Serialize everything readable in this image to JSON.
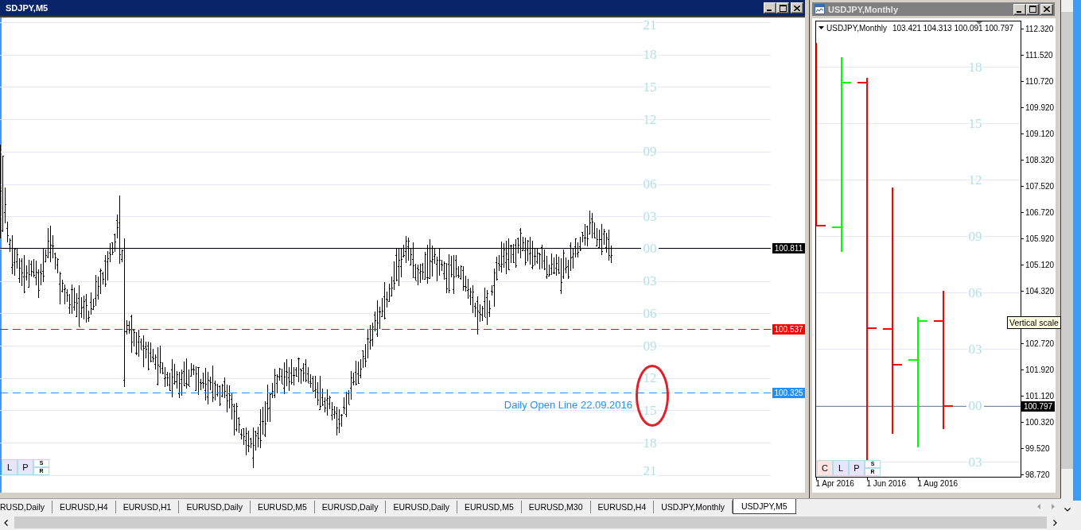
{
  "m5_window": {
    "title": "SDJPY,M5",
    "active": true,
    "hour_labels": [
      "21",
      "18",
      "15",
      "12",
      "09",
      "06",
      "03",
      "00",
      "03",
      "06",
      "09",
      "12",
      "15",
      "18",
      "21"
    ],
    "price_lines": [
      {
        "kind": "solid",
        "color": "#000000",
        "tag": "100.811"
      },
      {
        "kind": "dashed",
        "color": "#ff0000",
        "tag": "100.537"
      },
      {
        "kind": "dashed",
        "color": "#1e90ff",
        "tag": "100.325",
        "label": "Daily Open Line 22.09.2016"
      }
    ],
    "annotations": [
      {
        "kind": "ellipse"
      }
    ],
    "buttons": [
      {
        "label": "L",
        "color": "#e6e6fa"
      },
      {
        "label": "P",
        "color": "#e6e6fa"
      }
    ],
    "stacked_buttons": [
      "S",
      "R"
    ]
  },
  "monthly_window": {
    "title": "USDJPY,Monthly",
    "active": false,
    "legend": {
      "symbol": "USDJPY,Monthly",
      "values": [
        "103.421",
        "104.313",
        "100.091",
        "100.797"
      ]
    },
    "hour_labels": [
      "18",
      "15",
      "12",
      "09",
      "06",
      "03",
      "00",
      "03"
    ],
    "bid_tag": "100.797",
    "price_axis": [
      "112.320",
      "111.520",
      "110.720",
      "109.920",
      "109.120",
      "108.320",
      "107.520",
      "106.720",
      "105.920",
      "105.120",
      "104.320",
      "102.720",
      "101.920",
      "101.120",
      "100.320",
      "99.520",
      "98.720"
    ],
    "date_axis": [
      "1 Apr 2016",
      "1 Jun 2016",
      "1 Aug 2016"
    ],
    "buttons": [
      {
        "label": "C",
        "color": "#ffe4e1"
      },
      {
        "label": "L",
        "color": "#e6e6fa"
      },
      {
        "label": "P",
        "color": "#e6e6fa"
      }
    ],
    "stacked_buttons": [
      "S",
      "R"
    ],
    "tooltip": "Vertical scale"
  },
  "tabs": [
    {
      "label": "RUSD,Daily",
      "selected": false
    },
    {
      "label": "EURUSD,H4",
      "selected": false
    },
    {
      "label": "EURUSD,H1",
      "selected": false
    },
    {
      "label": "EURUSD,Daily",
      "selected": false
    },
    {
      "label": "EURUSD,M5",
      "selected": false
    },
    {
      "label": "EURUSD,Daily",
      "selected": false
    },
    {
      "label": "EURUSD,Daily",
      "selected": false
    },
    {
      "label": "EURUSD,M5",
      "selected": false
    },
    {
      "label": "EURUSD,M30",
      "selected": false
    },
    {
      "label": "EURUSD,H4",
      "selected": false
    },
    {
      "label": "USDJPY,Monthly",
      "selected": false
    },
    {
      "label": "USDJPY,M5",
      "selected": true
    }
  ]
}
